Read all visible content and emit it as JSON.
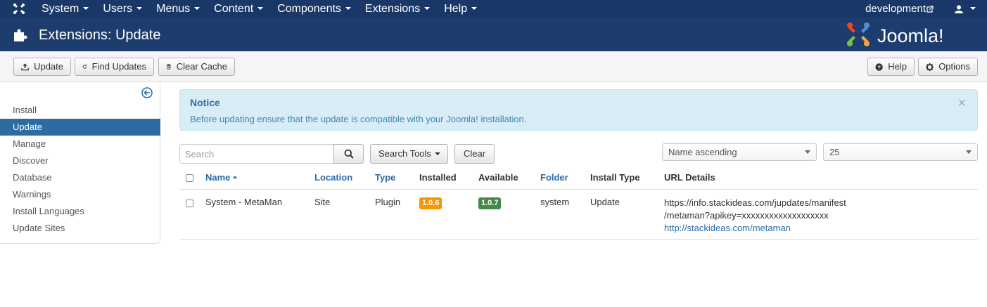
{
  "navbar": {
    "menu": [
      "System",
      "Users",
      "Menus",
      "Content",
      "Components",
      "Extensions",
      "Help"
    ],
    "site_link": "development"
  },
  "header": {
    "title": "Extensions: Update",
    "brand": "Joomla!"
  },
  "toolbar": {
    "update": "Update",
    "find_updates": "Find Updates",
    "clear_cache": "Clear Cache",
    "help": "Help",
    "options": "Options"
  },
  "sidebar": {
    "items": [
      "Install",
      "Update",
      "Manage",
      "Discover",
      "Database",
      "Warnings",
      "Install Languages",
      "Update Sites"
    ],
    "active": "Update"
  },
  "notice": {
    "title": "Notice",
    "text": "Before updating ensure that the update is compatible with your Joomla! installation.",
    "close": "×"
  },
  "filters": {
    "search_placeholder": "Search",
    "search_tools": "Search Tools",
    "clear": "Clear",
    "ordering": "Name ascending",
    "limit": "25"
  },
  "table": {
    "headers": {
      "name": "Name",
      "location": "Location",
      "type": "Type",
      "installed": "Installed",
      "available": "Available",
      "folder": "Folder",
      "install_type": "Install Type",
      "url_details": "URL Details"
    },
    "rows": [
      {
        "name": "System - MetaMan",
        "location": "Site",
        "type": "Plugin",
        "installed": "1.0.6",
        "available": "1.0.7",
        "folder": "system",
        "install_type": "Update",
        "url_line1": "https://info.stackideas.com/jupdates/manifest",
        "url_line2": "/metaman?apikey=xxxxxxxxxxxxxxxxxxx",
        "info_url": "http://stackideas.com/metaman"
      }
    ]
  },
  "colors": {
    "navbar": "#1a3867",
    "header": "#1c3d6e",
    "active": "#2d6ca2",
    "badge_installed": "#f89406",
    "badge_available": "#468847"
  }
}
